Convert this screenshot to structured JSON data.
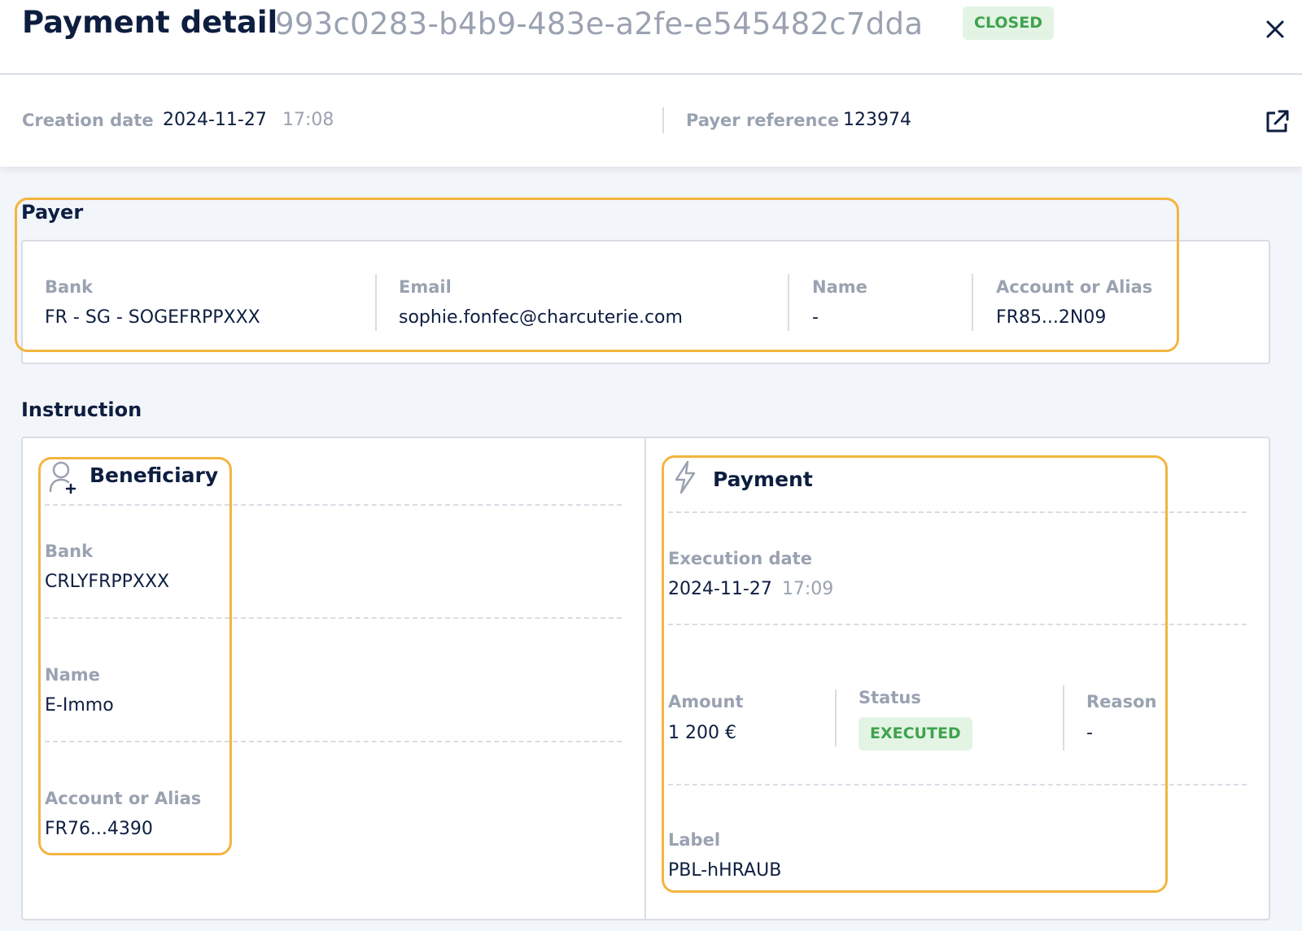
{
  "header": {
    "title": "Payment detail",
    "payment_id": "993c0283-b4b9-483e-a2fe-e545482c7dda",
    "status_badge": "CLOSED",
    "close_icon": "close-icon",
    "creation_date_label": "Creation date",
    "creation_date": "2024-11-27",
    "creation_time": "17:08",
    "payer_reference_label": "Payer reference",
    "payer_reference": "123974",
    "external_link_icon": "external-link-icon"
  },
  "payer": {
    "section_title": "Payer",
    "bank_label": "Bank",
    "bank": "FR - SG - SOGEFRPPXXX",
    "email_label": "Email",
    "email": "sophie.fonfec@charcuterie.com",
    "name_label": "Name",
    "name": "-",
    "account_label": "Account or Alias",
    "account": "FR85...2N09"
  },
  "instruction": {
    "section_title": "Instruction",
    "beneficiary": {
      "title": "Beneficiary",
      "icon": "user-plus-icon",
      "bank_label": "Bank",
      "bank": "CRLYFRPPXXX",
      "name_label": "Name",
      "name": "E-Immo",
      "account_label": "Account or Alias",
      "account": "FR76...4390"
    },
    "payment": {
      "title": "Payment",
      "icon": "lightning-icon",
      "execution_date_label": "Execution date",
      "execution_date": "2024-11-27",
      "execution_time": "17:09",
      "amount_label": "Amount",
      "amount": "1 200 €",
      "status_label": "Status",
      "status": "EXECUTED",
      "reason_label": "Reason",
      "reason": "-",
      "label_label": "Label",
      "label": "PBL-hHRAUB"
    }
  },
  "colors": {
    "highlight": "#f3b53f",
    "success_text": "#3fa34d",
    "success_bg": "#e3f4e4",
    "muted_text": "#9aa2b1",
    "primary_text": "#0d1e40"
  }
}
